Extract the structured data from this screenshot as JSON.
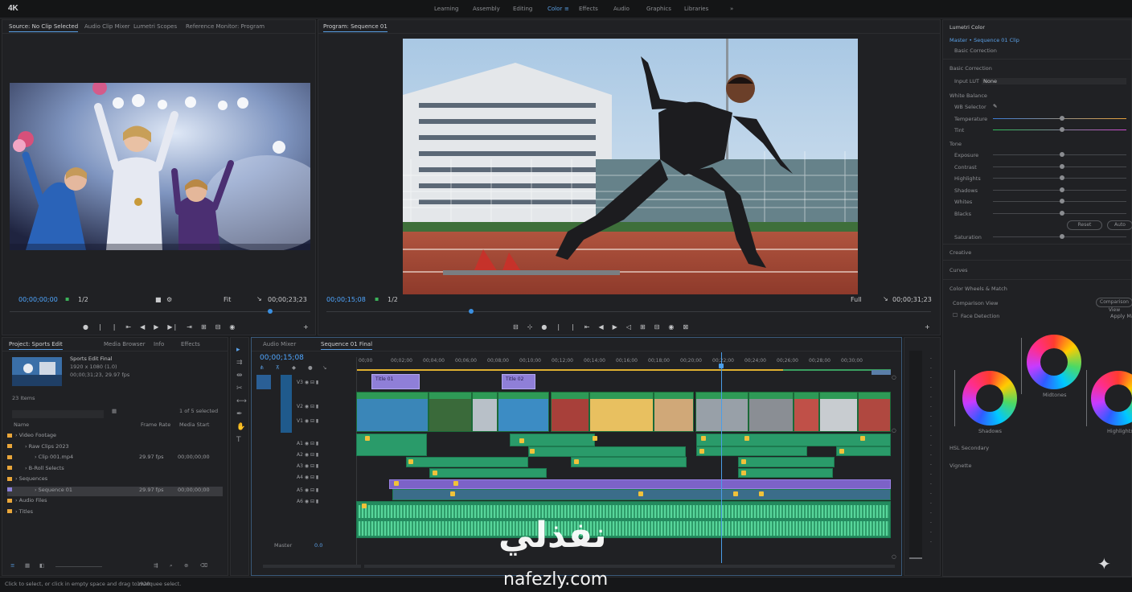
{
  "app": {
    "logo": "4K"
  },
  "workspaces": [
    "Learning",
    "Assembly",
    "Editing",
    "Color",
    "Effects",
    "Audio",
    "Graphics",
    "Libraries",
    "»"
  ],
  "active_workspace": 3,
  "source_monitor": {
    "tabs": [
      "Source: No Clip Selected",
      "Audio Clip Mixer",
      "Lumetri Scopes",
      "Reference Monitor: Program"
    ],
    "timecode_in": "00;00;00;00",
    "zoom": "1/2",
    "fit": "Fit",
    "timecode_out": "00;00;23;23"
  },
  "program_monitor": {
    "title": "Program: Sequence 01",
    "timecode_in": "00;00;15;08",
    "zoom": "1/2",
    "fit": "Full",
    "timecode_out": "00;00;31;23"
  },
  "lumetri": {
    "title": "Lumetri Color",
    "subtitle": "Master • Sequence 01 Clip",
    "section1": "Basic Correction",
    "input_label": "Input LUT",
    "input_value": "None",
    "white_balance": "White Balance",
    "wb_selector": "WB Selector",
    "temp": "Temperature",
    "tint": "Tint",
    "tone": "Tone",
    "tone_items": [
      "Exposure",
      "Contrast",
      "Highlights",
      "Shadows",
      "Whites",
      "Blacks"
    ],
    "saturation": "Saturation",
    "reset_label": "Reset",
    "auto_label": "Auto",
    "creative": "Creative",
    "curves": "Curves",
    "wheels_title": "Color Wheels & Match",
    "comparison": "Comparison View",
    "apply_match": "Apply Match",
    "face_detection": "Face Detection",
    "wheel_labels": [
      "Shadows",
      "Midtones",
      "Highlights"
    ],
    "hsl": "HSL Secondary",
    "vignette": "Vignette"
  },
  "project": {
    "tab": "Project: Sports Edit",
    "tabs": [
      "Media Browser",
      "Info",
      "Effects"
    ],
    "clip_info": [
      "Sports Edit Final",
      "1920 x 1080 (1.0)",
      "00;00;31;23, 29.97 fps"
    ],
    "item_count": "23 Items",
    "filter": "1 of 5 selected",
    "col_name": "Name",
    "col_fps": "Frame Rate",
    "col_start": "Media Start",
    "items": [
      {
        "name": "Video Footage",
        "fps": "",
        "start": "",
        "indent": 0
      },
      {
        "name": "Raw Clips 2023",
        "fps": "",
        "start": "",
        "indent": 1
      },
      {
        "name": "Clip 001.mp4",
        "fps": "29.97 fps",
        "start": "00;00;00;00",
        "indent": 2
      },
      {
        "name": "B-Roll Selects",
        "fps": "",
        "start": "",
        "indent": 1
      },
      {
        "name": "Sequences",
        "fps": "",
        "start": "",
        "indent": 0
      },
      {
        "name": "Sequence 01",
        "fps": "29.97 fps",
        "start": "00;00;00;00",
        "indent": 2
      },
      {
        "name": "Audio Files",
        "fps": "",
        "start": "",
        "indent": 0
      },
      {
        "name": "Titles",
        "fps": "",
        "start": "",
        "indent": 0
      }
    ]
  },
  "timeline": {
    "tabs": [
      "Audio Mixer",
      "Sequence 01 Final"
    ],
    "timecode": "00;00;15;08",
    "ruler": [
      "00;00",
      "00;02;00",
      "00;04;00",
      "00;06;00",
      "00;08;00",
      "00;10;00",
      "00;12;00",
      "00;14;00",
      "00;16;00",
      "00;18;00",
      "00;20;00",
      "00;22;00",
      "00;24;00",
      "00;26;00",
      "00;28;00",
      "00;30;00"
    ],
    "tracks_v": [
      "V3",
      "V2",
      "V1"
    ],
    "tracks_a": [
      "A1",
      "A2",
      "A3",
      "A4",
      "A5",
      "A6"
    ],
    "master": "Master",
    "master_val": "0.0",
    "title_clips": [
      "Title 01",
      "Title 02"
    ]
  },
  "status_bar": "Click to select, or click in empty space and drag to marquee select.",
  "status_frames": "1920",
  "watermark": {
    "arabic": "نفذلي",
    "url": "nafezly.com"
  }
}
